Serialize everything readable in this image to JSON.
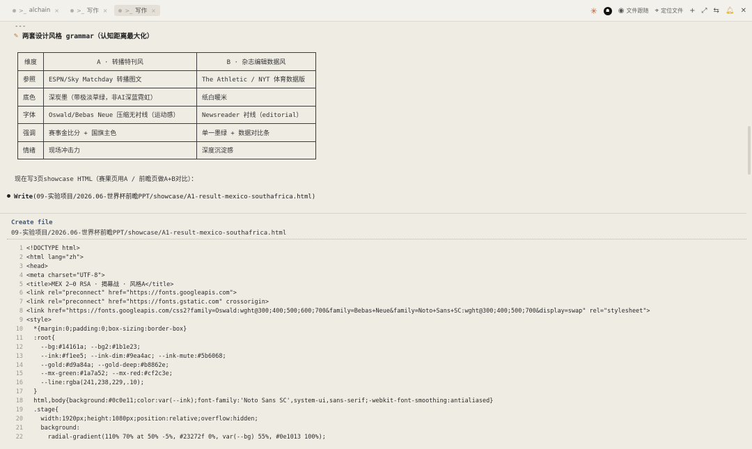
{
  "tabs": [
    {
      "label": "alchain",
      "active": false
    },
    {
      "label": "写作",
      "active": false
    },
    {
      "label": "写作",
      "active": true
    }
  ],
  "toolbar": {
    "file_follow": "文件跟随",
    "locate_file": "定位文件",
    "avatar_text": "☗"
  },
  "content": {
    "dashes": "---",
    "heading": "两套设计风格 grammar（认知距离最大化）",
    "table": {
      "headers": [
        "维度",
        "A · 转播特刊风",
        "B · 杂志编辑数据风"
      ],
      "rows": [
        [
          "参照",
          "ESPN/Sky Matchday 转播图文",
          "The Athletic / NYT 体育数据版"
        ],
        [
          "底色",
          "深炭墨（带极淡草绿，非AI深蓝霓虹）",
          "纸白暖米"
        ],
        [
          "字体",
          "Oswald/Bebas Neue 压缩无衬线（运动感）",
          "Newsreader 衬线（editorial）"
        ],
        [
          "强调",
          "赛事金比分 + 国旗主色",
          "单一墨绿 + 数据对比条"
        ],
        [
          "情绪",
          "现场冲击力",
          "深度沉淀感"
        ]
      ]
    },
    "note": "现在写3页showcase HTML（赛果页用A / 前瞻页做A+B对比）：",
    "write_label": "Write",
    "write_path": "(09-实验项目/2026.06-世界杯前瞻PPT/showcase/A1-result-mexico-southafrica.html)",
    "create_title": "Create file",
    "create_path": "09-实验项目/2026.06-世界杯前瞻PPT/showcase/A1-result-mexico-southafrica.html"
  },
  "code_lines": [
    "<!DOCTYPE html>",
    "<html lang=\"zh\">",
    "<head>",
    "<meta charset=\"UTF-8\">",
    "<title>MEX 2–0 RSA · 揭幕战 · 风格A</title>",
    "<link rel=\"preconnect\" href=\"https://fonts.googleapis.com\">",
    "<link rel=\"preconnect\" href=\"https://fonts.gstatic.com\" crossorigin>",
    "<link href=\"https://fonts.googleapis.com/css2?family=Oswald:wght@300;400;500;600;700&family=Bebas+Neue&family=Noto+Sans+SC:wght@300;400;500;700&display=swap\" rel=\"stylesheet\">",
    "<style>",
    "  *{margin:0;padding:0;box-sizing:border-box}",
    "  :root{",
    "    --bg:#14161a; --bg2:#1b1e23;",
    "    --ink:#f1ee5; --ink-dim:#9ea4ac; --ink-mute:#5b6068;",
    "    --gold:#d9a84a; --gold-deep:#b8862e;",
    "    --mx-green:#1a7a52; --mx-red:#cf2c3e;",
    "    --line:rgba(241,238,229,.10);",
    "  }",
    "  html,body{background:#0c0e11;color:var(--ink);font-family:'Noto Sans SC',system-ui,sans-serif;-webkit-font-smoothing:antialiased}",
    "  .stage{",
    "    width:1920px;height:1080px;position:relative;overflow:hidden;",
    "    background:",
    "      radial-gradient(110% 70% at 50% -5%, #23272f 0%, var(--bg) 55%, #0e1013 100%);"
  ]
}
